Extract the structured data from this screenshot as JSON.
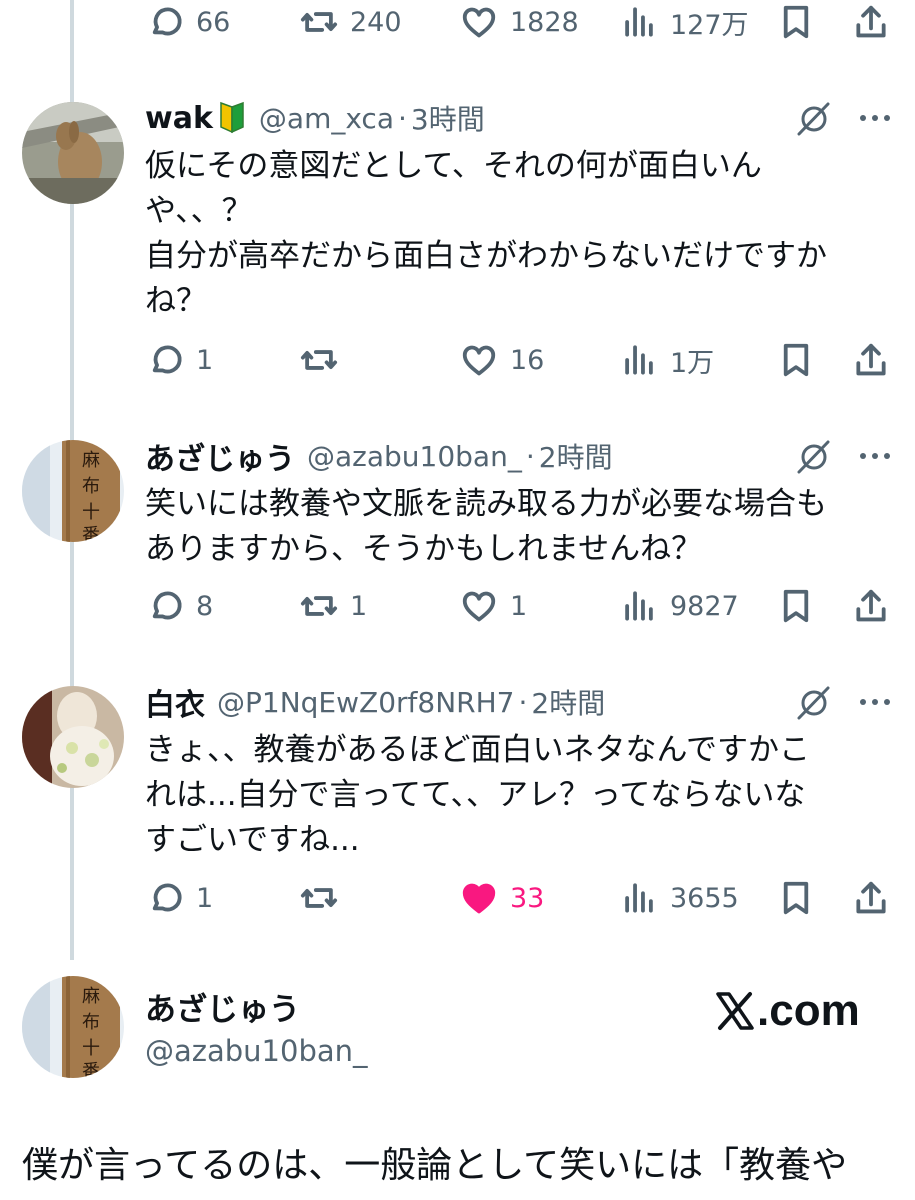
{
  "top_actions": {
    "reply": "66",
    "retweet": "240",
    "like": "1828",
    "views": "127万"
  },
  "tweets": [
    {
      "name": "wak",
      "handle": "@am_xca",
      "time": "3時間",
      "lines": [
        "仮にその意図だとして、それの何が面白いん",
        "や、、？",
        "自分が高卒だから面白さがわからないだけですか",
        "ね？"
      ],
      "reply": "1",
      "retweet": "",
      "like": "16",
      "views": "1万"
    },
    {
      "name": "あざじゅう",
      "handle": "@azabu10ban_",
      "time": "2時間",
      "lines": [
        "笑いには教養や文脈を読み取る力が必要な場合も",
        "ありますから、そうかもしれませんね？"
      ],
      "reply": "8",
      "retweet": "1",
      "like": "1",
      "views": "9827"
    },
    {
      "name": "白衣",
      "handle": "@P1NqEwZ0rf8NRH7",
      "time": "2時間",
      "lines": [
        "きょ、、教養があるほど面白いネタなんですかこ",
        "れは...自分で言ってて、、アレ？ってならないな",
        "すごいですね..."
      ],
      "reply": "1",
      "retweet": "",
      "like": "33",
      "views": "3655"
    }
  ],
  "card": {
    "name": "あざじゅう",
    "handle": "@azabu10ban_",
    "logo": ".com",
    "text": "僕が言ってるのは、一般論として笑いには「教養や"
  },
  "separator": "·",
  "colors": {
    "secondary": "#536471",
    "like_active": "#f91880",
    "thread_line": "#cfd9de"
  }
}
